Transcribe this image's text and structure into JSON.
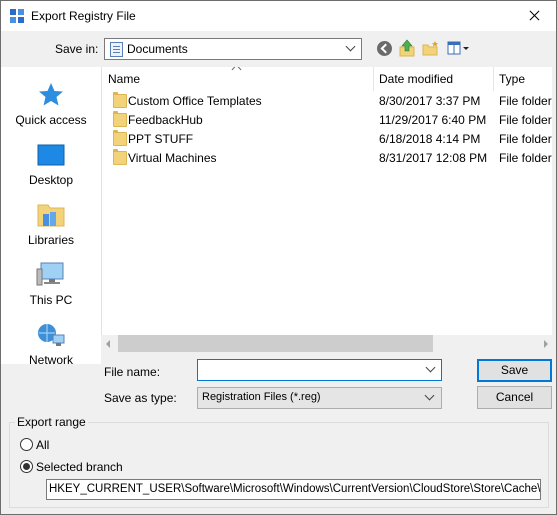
{
  "window": {
    "title": "Export Registry File"
  },
  "save_in": {
    "label": "Save in:",
    "value": "Documents"
  },
  "places": [
    {
      "name": "quick-access",
      "label": "Quick access",
      "icon": "star-icon"
    },
    {
      "name": "desktop",
      "label": "Desktop",
      "icon": "desktop-icon"
    },
    {
      "name": "libraries",
      "label": "Libraries",
      "icon": "libraries-icon"
    },
    {
      "name": "this-pc",
      "label": "This PC",
      "icon": "computer-icon"
    },
    {
      "name": "network",
      "label": "Network",
      "icon": "network-icon"
    }
  ],
  "file_list": {
    "columns": [
      "Name",
      "Date modified",
      "Type"
    ],
    "rows": [
      {
        "name": "Custom Office Templates",
        "date": "8/30/2017 3:37 PM",
        "type": "File folder"
      },
      {
        "name": "FeedbackHub",
        "date": "11/29/2017 6:40 PM",
        "type": "File folder"
      },
      {
        "name": "PPT STUFF",
        "date": "6/18/2018 4:14 PM",
        "type": "File folder"
      },
      {
        "name": "Virtual Machines",
        "date": "8/31/2017 12:08 PM",
        "type": "File folder"
      }
    ]
  },
  "file_name": {
    "label": "File name:",
    "value": ""
  },
  "save_as_type": {
    "label": "Save as type:",
    "value": "Registration Files (*.reg)"
  },
  "buttons": {
    "save": "Save",
    "cancel": "Cancel"
  },
  "export_range": {
    "title": "Export range",
    "all_label": "All",
    "selected_label": "Selected branch",
    "selected": "selected_branch",
    "branch_path": "HKEY_CURRENT_USER\\Software\\Microsoft\\Windows\\CurrentVersion\\CloudStore\\Store\\Cache\\Def"
  },
  "colors": {
    "accent": "#0078d7",
    "folder": "#f3d37a"
  }
}
